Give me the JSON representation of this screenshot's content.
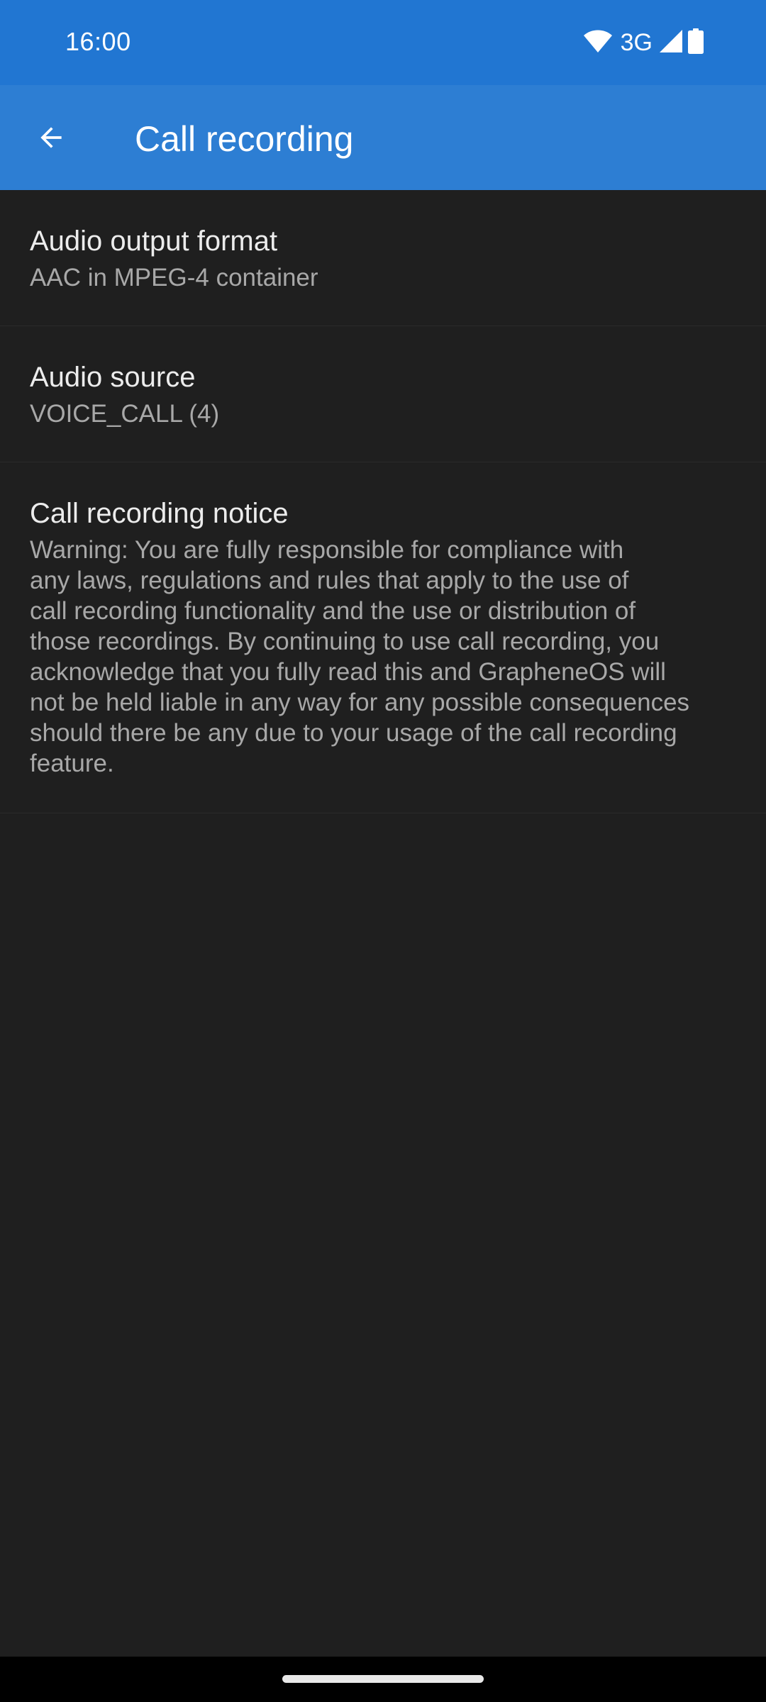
{
  "status_bar": {
    "time": "16:00",
    "network": "3G",
    "icons": [
      "wifi-icon",
      "signal-icon",
      "battery-icon"
    ]
  },
  "app_bar": {
    "title": "Call recording",
    "back_icon": "arrow-back-icon"
  },
  "preferences": [
    {
      "title": "Audio output format",
      "summary": "AAC in MPEG-4 container"
    },
    {
      "title": "Audio source",
      "summary": "VOICE_CALL (4)"
    },
    {
      "title": "Call recording notice",
      "summary": "Warning: You are fully responsible for compliance with\nany laws, regulations and rules that apply to the use of\ncall recording functionality and the use or distribution of\nthose recordings. By continuing to use call recording, you\nacknowledge that you fully read this and GrapheneOS will\nnot be held liable in any way for any possible consequences\nshould there be any due to your usage of the call recording\nfeature."
    }
  ],
  "colors": {
    "status_bar": "#2176d2",
    "app_bar": "#2d7ed3",
    "background": "#1f1f1f",
    "nav_bar": "#000000"
  }
}
